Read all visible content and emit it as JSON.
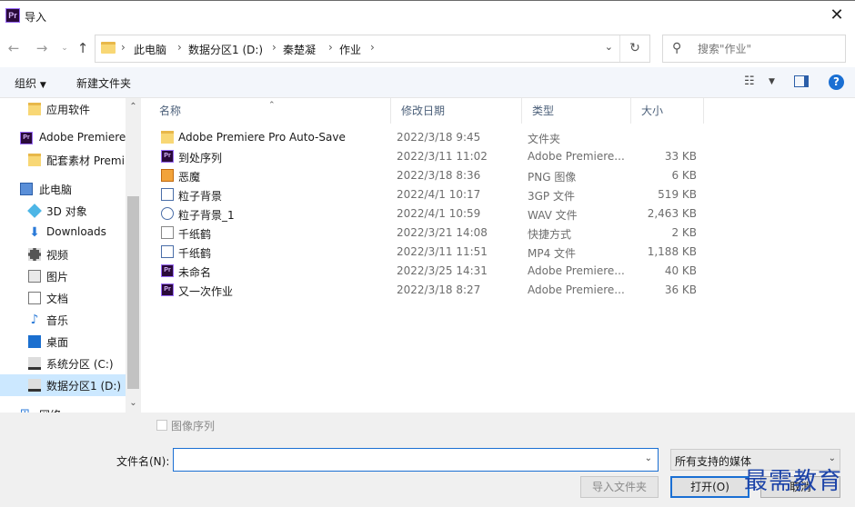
{
  "window": {
    "title": "导入",
    "app_icon": "Pr"
  },
  "address": {
    "crumbs": [
      "此电脑",
      "数据分区1 (D:)",
      "秦楚凝",
      "作业"
    ]
  },
  "search": {
    "placeholder": "搜索\"作业\""
  },
  "toolbar": {
    "organize": "组织",
    "new_folder": "新建文件夹"
  },
  "sidebar": {
    "items": [
      {
        "label": "应用软件",
        "icon": "folder-icon"
      },
      {
        "label": "Adobe Premiere",
        "icon": "premiere-icon"
      },
      {
        "label": "配套素材 Premi",
        "icon": "folder-icon"
      },
      {
        "label": "此电脑",
        "icon": "computer-icon"
      },
      {
        "label": "3D 对象",
        "icon": "3d-objects-icon"
      },
      {
        "label": "Downloads",
        "icon": "download-icon"
      },
      {
        "label": "视频",
        "icon": "video-icon"
      },
      {
        "label": "图片",
        "icon": "pictures-icon"
      },
      {
        "label": "文档",
        "icon": "documents-icon"
      },
      {
        "label": "音乐",
        "icon": "music-icon"
      },
      {
        "label": "桌面",
        "icon": "desktop-icon"
      },
      {
        "label": "系统分区 (C:)",
        "icon": "drive-icon"
      },
      {
        "label": "数据分区1 (D:)",
        "icon": "drive-icon"
      },
      {
        "label": "网络",
        "icon": "network-icon"
      }
    ],
    "selected": "数据分区1 (D:)"
  },
  "columns": {
    "name": "名称",
    "date": "修改日期",
    "type": "类型",
    "size": "大小"
  },
  "files": [
    {
      "name": "Adobe Premiere Pro Auto-Save",
      "date": "2022/3/18 9:45",
      "type": "文件夹",
      "size": "",
      "icon": "folder-icon"
    },
    {
      "name": "到处序列",
      "date": "2022/3/11 11:02",
      "type": "Adobe Premiere...",
      "size": "33 KB",
      "icon": "premiere-icon"
    },
    {
      "name": "恶魔",
      "date": "2022/3/18 8:36",
      "type": "PNG 图像",
      "size": "6 KB",
      "icon": "png-icon"
    },
    {
      "name": "粒子背景",
      "date": "2022/4/1 10:17",
      "type": "3GP 文件",
      "size": "519 KB",
      "icon": "video-file-icon"
    },
    {
      "name": "粒子背景_1",
      "date": "2022/4/1 10:59",
      "type": "WAV 文件",
      "size": "2,463 KB",
      "icon": "audio-file-icon"
    },
    {
      "name": "千纸鹤",
      "date": "2022/3/21 14:08",
      "type": "快捷方式",
      "size": "2 KB",
      "icon": "shortcut-icon"
    },
    {
      "name": "千纸鹤",
      "date": "2022/3/11 11:51",
      "type": "MP4 文件",
      "size": "1,188 KB",
      "icon": "video-file-icon"
    },
    {
      "name": "未命名",
      "date": "2022/3/25 14:31",
      "type": "Adobe Premiere...",
      "size": "40 KB",
      "icon": "premiere-icon"
    },
    {
      "name": "又一次作业",
      "date": "2022/3/18 8:27",
      "type": "Adobe Premiere...",
      "size": "36 KB",
      "icon": "premiere-icon"
    }
  ],
  "bottom": {
    "image_sequence": "图像序列",
    "filename_label": "文件名(N):",
    "filename_value": "",
    "filter_value": "所有支持的媒体",
    "import_folder": "导入文件夹",
    "open": "打开(O)",
    "cancel": "取消"
  },
  "watermark": "最需教育"
}
